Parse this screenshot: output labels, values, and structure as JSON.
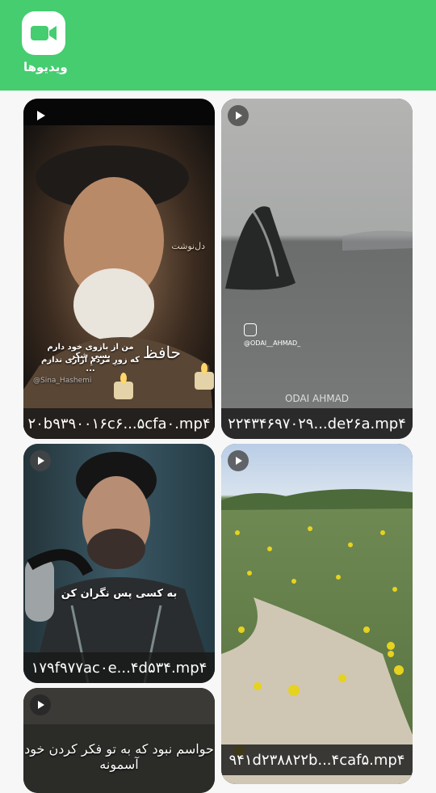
{
  "header": {
    "title": "ویدیوها",
    "icon": "video-camera-icon",
    "color": "#45cd70"
  },
  "videos": [
    {
      "filename": "۲۰b۹۳۹۰۰۱۶c۶...۵cfa۰.mp۴",
      "overlay_line1": "من از بازوی خود دارم بسی شکر",
      "overlay_line2": "که زورِ مردمِ آزاری ندارم ...",
      "signature": "حافظ",
      "handle": "@Sina_Hashemi",
      "corner_text": "دل‌نوشت"
    },
    {
      "filename": "۲۲۴۳۴۶۹۷۰۲۹...de۲۶a.mp۴",
      "instagram": "@ODAI__AHMAD_",
      "watermark": "ODAI AHMAD"
    },
    {
      "filename": "۱۷۹f۹۷۷ac۰e...۴d۵۳۴.mp۴",
      "overlay": "به کسی پس نگران کن"
    },
    {
      "filename": "۹۴۱d۲۳۸۸۲۲b...۴caf۵.mp۴"
    },
    {
      "overlay": "حواسم نبود که به تو فکر کردن خود آسمونه"
    }
  ]
}
